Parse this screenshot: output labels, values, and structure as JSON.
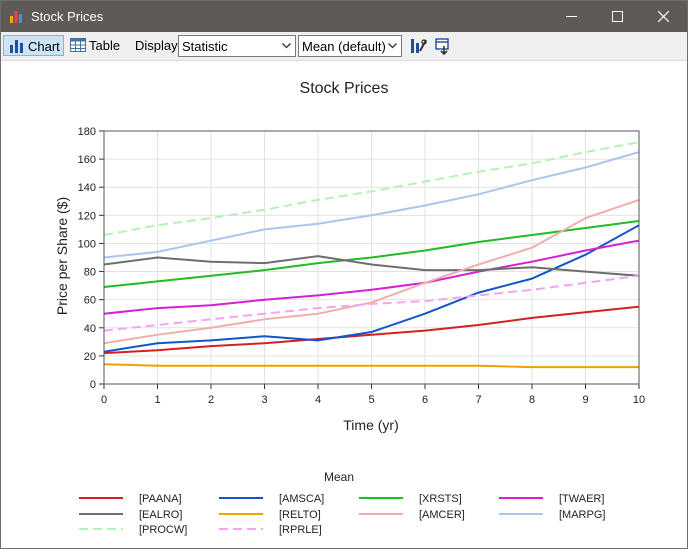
{
  "window": {
    "title": "Stock Prices"
  },
  "toolbar": {
    "chart_label": "Chart",
    "table_label": "Table",
    "display_label": "Display:",
    "display_value": "Statistic",
    "stat_value": "Mean (default)"
  },
  "colors": {
    "titlebar": "#5d5a57",
    "active_button": "#cce4f7"
  },
  "chart_data": {
    "type": "line",
    "title": "Stock Prices",
    "xlabel": "Time (yr)",
    "ylabel": "Price per Share ($)",
    "xlim": [
      0,
      10
    ],
    "ylim": [
      0,
      180
    ],
    "x_ticks": [
      0,
      1,
      2,
      3,
      4,
      5,
      6,
      7,
      8,
      9,
      10
    ],
    "y_ticks": [
      0,
      20,
      40,
      60,
      80,
      100,
      120,
      140,
      160,
      180
    ],
    "grid": true,
    "legend_title": "Mean",
    "legend_position": "bottom",
    "x": [
      0,
      1,
      2,
      3,
      4,
      5,
      6,
      7,
      8,
      9,
      10
    ],
    "series": [
      {
        "name": "[PAANA]",
        "color": "#d42020",
        "dash": "solid",
        "values": [
          22,
          24,
          27,
          29,
          32,
          35,
          38,
          42,
          47,
          51,
          55
        ]
      },
      {
        "name": "[AMSCA]",
        "color": "#1155cc",
        "dash": "solid",
        "values": [
          23,
          29,
          31,
          34,
          31,
          37,
          50,
          65,
          75,
          92,
          113
        ]
      },
      {
        "name": "[XRSTS]",
        "color": "#22bb22",
        "dash": "solid",
        "values": [
          69,
          73,
          77,
          81,
          86,
          90,
          95,
          101,
          106,
          111,
          116
        ]
      },
      {
        "name": "[TWAER]",
        "color": "#d61fd6",
        "dash": "solid",
        "values": [
          50,
          54,
          56,
          60,
          63,
          67,
          72,
          80,
          87,
          95,
          102
        ]
      },
      {
        "name": "[EALRO]",
        "color": "#6e6e6e",
        "dash": "solid",
        "values": [
          85,
          90,
          87,
          86,
          91,
          85,
          81,
          81,
          83,
          80,
          77
        ]
      },
      {
        "name": "[RELTO]",
        "color": "#f0a000",
        "dash": "solid",
        "values": [
          14,
          13,
          13,
          13,
          13,
          13,
          13,
          13,
          12,
          12,
          12
        ]
      },
      {
        "name": "[AMCER]",
        "color": "#f2aeae",
        "dash": "solid",
        "values": [
          29,
          35,
          40,
          46,
          50,
          58,
          72,
          85,
          97,
          118,
          131
        ]
      },
      {
        "name": "[MARPG]",
        "color": "#abc4f2",
        "dash": "solid",
        "values": [
          90,
          94,
          102,
          110,
          114,
          120,
          127,
          135,
          145,
          154,
          165
        ]
      },
      {
        "name": "[PROCW]",
        "color": "#b5f2b5",
        "dash": "dashed",
        "values": [
          106,
          113,
          118,
          124,
          131,
          137,
          144,
          151,
          157,
          165,
          172
        ]
      },
      {
        "name": "[RPRLE]",
        "color": "#f2a6f2",
        "dash": "dashed",
        "values": [
          38,
          42,
          46,
          50,
          54,
          57,
          59,
          63,
          67,
          72,
          77
        ]
      }
    ]
  }
}
